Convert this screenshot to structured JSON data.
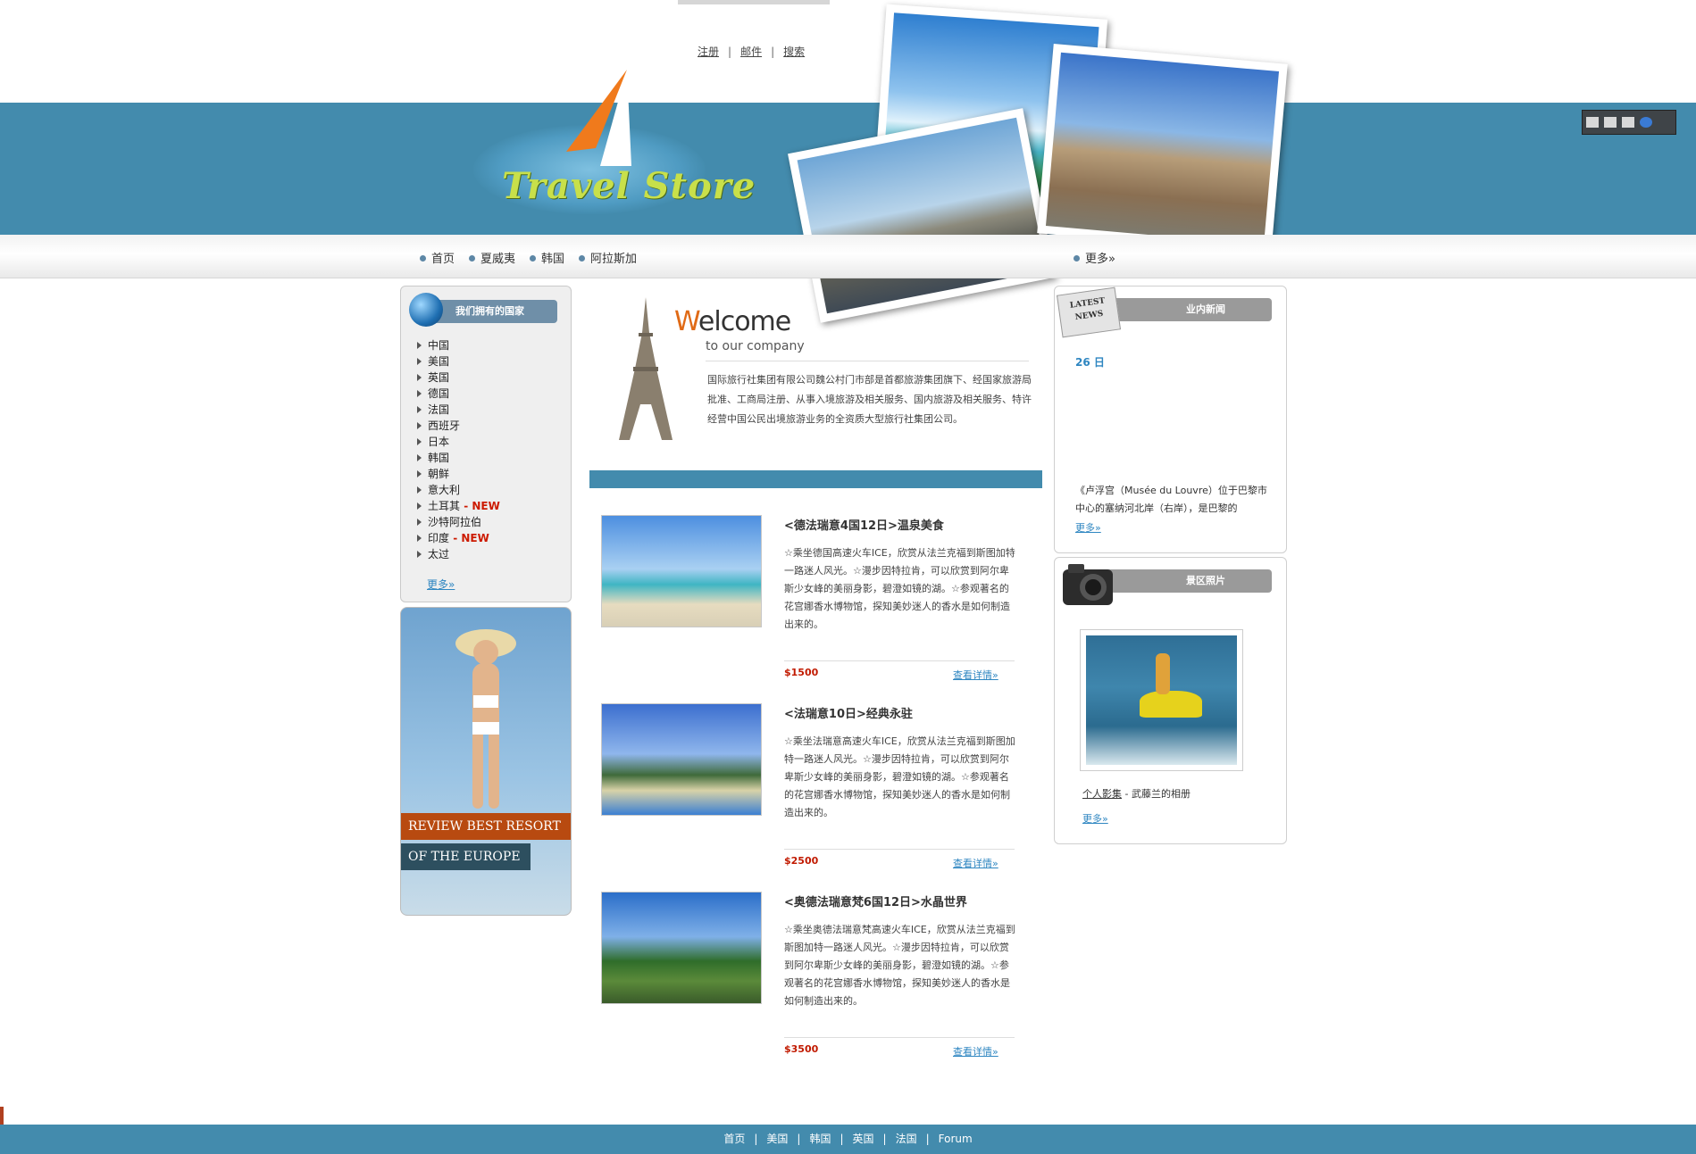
{
  "top_links": [
    "注册",
    "邮件",
    "搜索"
  ],
  "top_separator": "|",
  "logo": {
    "text": "Travel Store"
  },
  "nav": {
    "items": [
      "首页",
      "夏威夷",
      "韩国",
      "阿拉斯加"
    ],
    "more": "更多»"
  },
  "left_panel": {
    "title": "我们拥有的国家",
    "countries": [
      {
        "name": "中国",
        "tag": ""
      },
      {
        "name": "美国",
        "tag": ""
      },
      {
        "name": "英国",
        "tag": ""
      },
      {
        "name": "德国",
        "tag": ""
      },
      {
        "name": "法国",
        "tag": ""
      },
      {
        "name": "西班牙",
        "tag": ""
      },
      {
        "name": "日本",
        "tag": ""
      },
      {
        "name": "韩国",
        "tag": ""
      },
      {
        "name": "朝鲜",
        "tag": ""
      },
      {
        "name": "意大利",
        "tag": ""
      },
      {
        "name": "土耳其",
        "tag": " - NEW"
      },
      {
        "name": "沙特阿拉伯",
        "tag": ""
      },
      {
        "name": "印度",
        "tag": " - NEW"
      },
      {
        "name": "太过",
        "tag": ""
      }
    ],
    "more": "更多»"
  },
  "promo": {
    "line1": "REVIEW BEST RESORT",
    "line2": "OF THE EUROPE"
  },
  "welcome": {
    "title_initial": "W",
    "title_rest": "elcome",
    "subtitle": "to our company",
    "intro": "国际旅行社集团有限公司魏公村门市部是首都旅游集团旗下、经国家旅游局批准、工商局注册、从事入境旅游及相关服务、国内旅游及相关服务、特许经营中国公民出境旅游业务的全资质大型旅行社集团公司。"
  },
  "tours": [
    {
      "title": "<德法瑞意4国12日>温泉美食",
      "desc": "☆乘坐德国高速火车ICE，欣赏从法兰克福到斯图加特一路迷人风光。☆漫步因特拉肯，可以欣赏到阿尔卑斯少女峰的美丽身影，碧澄如镜的湖。☆参观著名的花宫娜香水博物馆，探知美妙迷人的香水是如何制造出来的。",
      "price": "$1500",
      "detail": "查看详情»"
    },
    {
      "title": "<法瑞意10日>经典永驻",
      "desc": "☆乘坐法瑞意高速火车ICE，欣赏从法兰克福到斯图加特一路迷人风光。☆漫步因特拉肯，可以欣赏到阿尔卑斯少女峰的美丽身影，碧澄如镜的湖。☆参观著名的花宫娜香水博物馆，探知美妙迷人的香水是如何制造出来的。",
      "price": "$2500",
      "detail": "查看详情»"
    },
    {
      "title": "<奥德法瑞意梵6国12日>水晶世界",
      "desc": "☆乘坐奥德法瑞意梵高速火车ICE，欣赏从法兰克福到斯图加特一路迷人风光。☆漫步因特拉肯，可以欣赏到阿尔卑斯少女峰的美丽身影，碧澄如镜的湖。☆参观著名的花宫娜香水博物馆，探知美妙迷人的香水是如何制造出来的。",
      "price": "$3500",
      "detail": "查看详情»"
    }
  ],
  "news": {
    "badge": "LATEST NEWS",
    "title": "业内新闻",
    "date": "26 日",
    "text": "《卢浮宫（Musée du Louvre）位于巴黎市中心的塞纳河北岸（右岸），是巴黎的",
    "more": "更多»"
  },
  "scenic": {
    "title": "景区照片",
    "caption_link": "个人影集",
    "caption_rest": " - 武藤兰的相册",
    "more": "更多»"
  },
  "footer": {
    "links": [
      "首页",
      "美国",
      "韩国",
      "英国",
      "法国",
      "Forum"
    ],
    "separator": "|"
  },
  "colors": {
    "band": "#438bad",
    "accent": "#e06a16",
    "price": "#c11a00",
    "link": "#2e86c1"
  }
}
